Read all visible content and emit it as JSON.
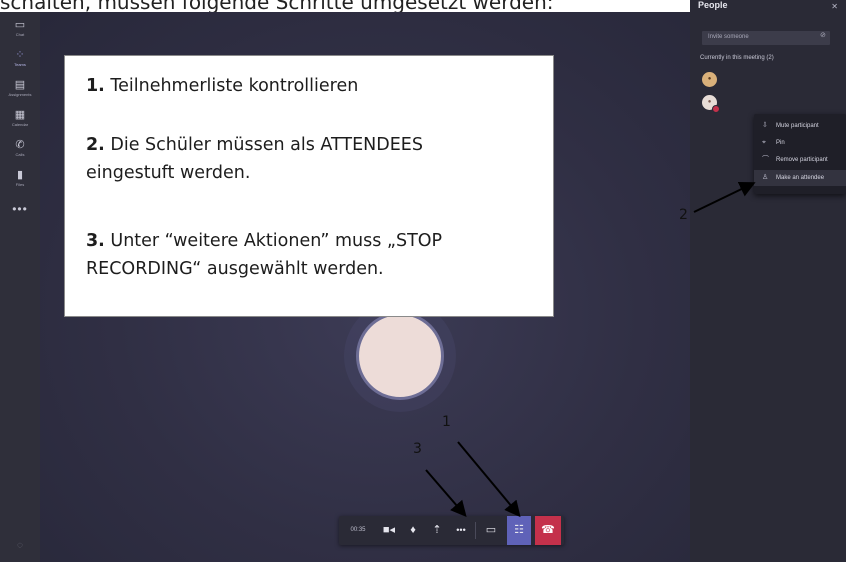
{
  "caption": "schalten, müssen folgende Schritte umgesetzt werden:",
  "rail": {
    "items": [
      {
        "label": "Chat",
        "icon": "chat-icon"
      },
      {
        "label": "Teams",
        "icon": "teams-icon"
      },
      {
        "label": "Assignments",
        "icon": "assignments-icon"
      },
      {
        "label": "Calendar",
        "icon": "calendar-icon"
      },
      {
        "label": "Calls",
        "icon": "calls-icon"
      },
      {
        "label": "Files",
        "icon": "files-icon"
      }
    ],
    "active_index": 1,
    "more": "•••"
  },
  "call_bar": {
    "timer": "00:35",
    "buttons": [
      "camera-icon",
      "microphone-icon",
      "share-screen-icon",
      "more-actions-icon",
      "chat-icon",
      "participants-icon",
      "hang-up-icon"
    ],
    "more_glyph": "•••"
  },
  "people_panel": {
    "title": "People",
    "invite_placeholder": "Invite someone",
    "section_label": "Currently in this meeting (2)"
  },
  "context_menu": {
    "items": [
      {
        "label": "Mute participant",
        "icon": "mic-off-icon"
      },
      {
        "label": "Pin",
        "icon": "pin-icon"
      },
      {
        "label": "Remove participant",
        "icon": "remove-icon"
      },
      {
        "label": "Make an attendee",
        "icon": "attendee-icon"
      }
    ]
  },
  "instructions": {
    "step1_num": "1.",
    "step1_text": " Teilnehmerliste kontrollieren",
    "step2_num": "2.",
    "step2_text_a": " Die Schüler müssen als ATTENDEES",
    "step2_text_b": "eingestuft werden.",
    "step3_num": "3.",
    "step3_text_a": " Unter “weitere Aktionen” muss „STOP",
    "step3_text_b": "RECORDING“ ausgewählt werden."
  },
  "annotations": {
    "one": "1",
    "two": "2",
    "three": "3"
  }
}
